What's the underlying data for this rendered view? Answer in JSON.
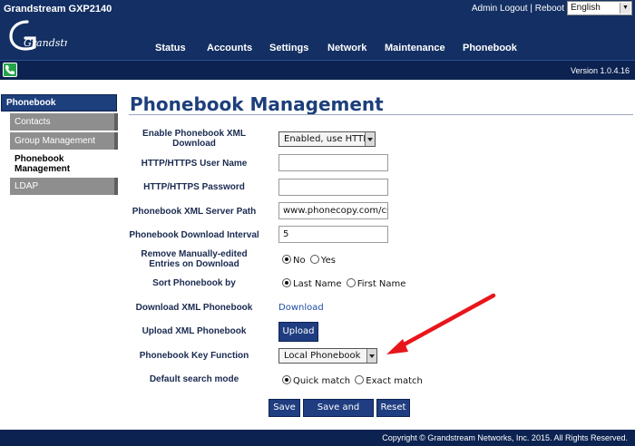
{
  "header": {
    "model": "Grandstream GXP2140",
    "admin_logout": "Admin Logout",
    "separator": "|",
    "reboot": "Reboot",
    "language": "English",
    "logo_text": "Grandstream",
    "nav": [
      "Status",
      "Accounts",
      "Settings",
      "Network",
      "Maintenance",
      "Phonebook"
    ]
  },
  "subbar": {
    "version": "Version 1.0.4.16",
    "phone_icon": "phone-icon"
  },
  "sidebar": {
    "title": "Phonebook",
    "items": [
      {
        "label": "Contacts",
        "selected": false
      },
      {
        "label": "Group Management",
        "selected": false
      },
      {
        "label": "Phonebook Management",
        "selected": true
      },
      {
        "label": "LDAP",
        "selected": false
      }
    ]
  },
  "main": {
    "title": "Phonebook Management",
    "fields": {
      "enable_xml": {
        "label": "Enable Phonebook XML Download",
        "value": "Enabled, use HTTPS"
      },
      "user_name": {
        "label": "HTTP/HTTPS User Name",
        "value": ""
      },
      "password": {
        "label": "HTTP/HTTPS Password",
        "value": ""
      },
      "server_path": {
        "label": "Phonebook XML Server Path",
        "value": "www.phonecopy.com/cs/xml"
      },
      "interval": {
        "label": "Phonebook Download Interval",
        "value": "5"
      },
      "remove_manual": {
        "label": "Remove Manually-edited Entries on Download",
        "options": [
          "No",
          "Yes"
        ],
        "selected": "No"
      },
      "sort_by": {
        "label": "Sort Phonebook by",
        "options": [
          "Last Name",
          "First Name"
        ],
        "selected": "Last Name"
      },
      "download_xml": {
        "label": "Download XML Phonebook",
        "link": "Download"
      },
      "upload_xml": {
        "label": "Upload XML Phonebook",
        "button": "Upload"
      },
      "key_function": {
        "label": "Phonebook Key Function",
        "value": "Local Phonebook"
      },
      "search_mode": {
        "label": "Default search mode",
        "options": [
          "Quick match",
          "Exact match"
        ],
        "selected": "Quick match"
      }
    },
    "buttons": {
      "save": "Save",
      "save_apply": "Save and Apply",
      "reset": "Reset"
    },
    "annotation_color": "#e8161b"
  },
  "footer": {
    "copyright": "Copyright © Grandstream Networks, Inc. 2015. All Rights Reserved."
  },
  "colors": {
    "header_bg": "#132f63",
    "subbar_bg": "#0c2250",
    "accent": "#1d3f7c",
    "button": "#1f3d80",
    "sidebar_item": "#8e8e8e"
  }
}
